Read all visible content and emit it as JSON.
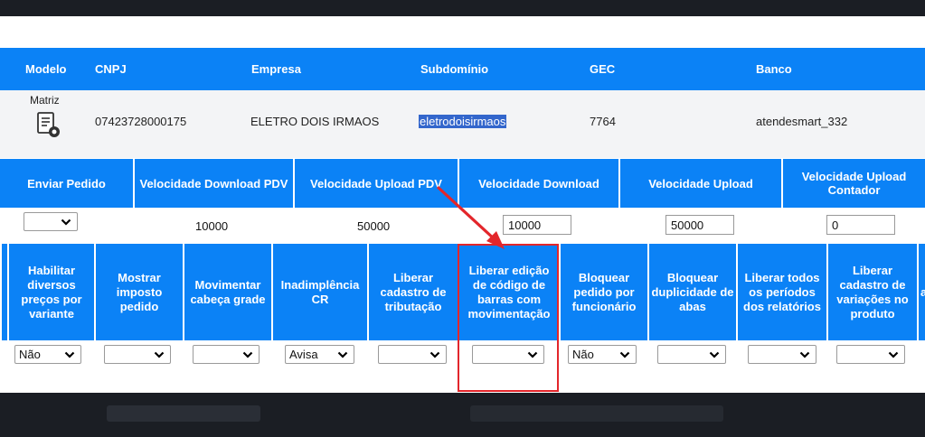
{
  "company_table": {
    "headers": [
      "Modelo",
      "CNPJ",
      "Empresa",
      "Subdomínio",
      "GEC",
      "Banco"
    ],
    "modelo": "Matriz",
    "cnpj": "07423728000175",
    "empresa": "ELETRO DOIS IRMAOS",
    "subdominio": "eletrodoisirmaos",
    "gec": "7764",
    "banco": "atendesmart_332"
  },
  "settings_table_1": {
    "headers": [
      "Enviar Pedido",
      "Velocidade Download PDV",
      "Velocidade Upload PDV",
      "Velocidade Download",
      "Velocidade Upload",
      "Velocidade Upload Contador"
    ],
    "enviar_pedido_value": "",
    "velocidade_download_pdv": "10000",
    "velocidade_upload_pdv": "50000",
    "velocidade_download": "10000",
    "velocidade_upload": "50000",
    "velocidade_upload_contador": "0"
  },
  "settings_table_2": {
    "headers": [
      "Habilitar diversos preços por variante",
      "Mostrar imposto pedido",
      "Movimentar cabeça grade",
      "Inadimplência CR",
      "Liberar cadastro de tributação",
      "Liberar edição de código de barras com movimentação",
      "Bloquear pedido por funcionário",
      "Bloquear duplicidade de abas",
      "Liberar todos os períodos dos relatórios",
      "Liberar cadastro de variações no produto",
      "a"
    ],
    "values": [
      "Não",
      "",
      "",
      "Avisa",
      "",
      "",
      "Não",
      "",
      "",
      ""
    ]
  },
  "colors": {
    "header_blue": "#0b82f6",
    "annotation_red": "#e3262b",
    "selection_blue": "#3366cc"
  }
}
